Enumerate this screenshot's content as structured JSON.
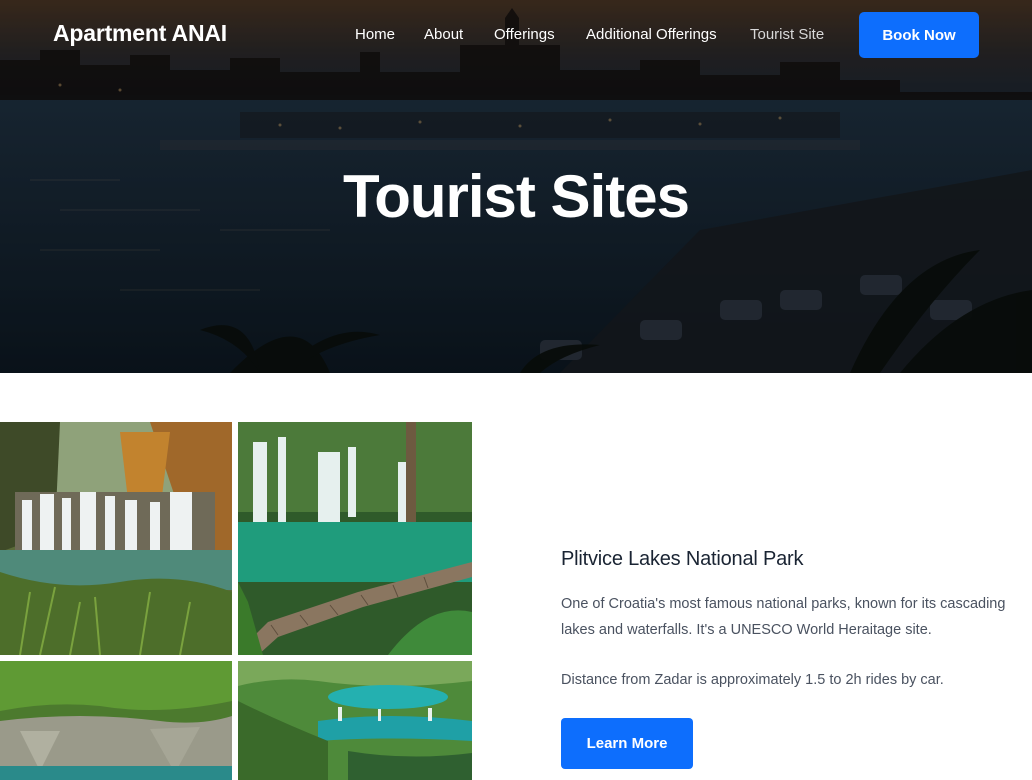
{
  "brand": {
    "name": "Apartment ANAI"
  },
  "nav": {
    "items": [
      {
        "label": "Home"
      },
      {
        "label": "About"
      },
      {
        "label": "Offerings"
      },
      {
        "label": "Additional Offerings"
      },
      {
        "label": "Tourist Site"
      }
    ],
    "cta_label": "Book Now"
  },
  "hero": {
    "title": "Tourist Sites"
  },
  "site": {
    "title": "Plitvice Lakes National Park",
    "description": "One of Croatia's most famous national parks, known for its cascading lakes and waterfalls. It's a UNESCO World Heraitage site.",
    "distance": "Distance from Zadar is approximately 1.5 to 2h rides by car.",
    "button_label": "Learn More"
  },
  "colors": {
    "accent": "#0d6efd",
    "text_dark": "#1a2433",
    "text_muted": "#4a5260"
  }
}
